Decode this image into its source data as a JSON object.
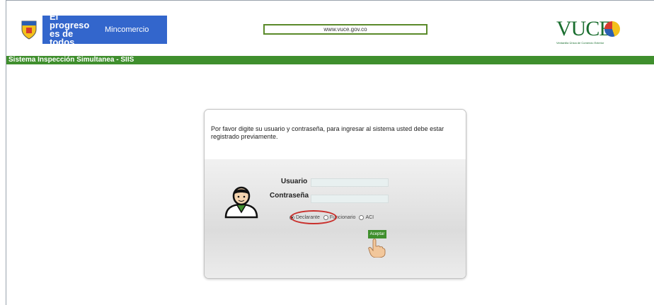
{
  "header": {
    "gov_logo_text": "El progreso es de todos",
    "ministry": "Mincomercio",
    "url": "www.vuce.gov.co",
    "vuce_logo": "VUCE",
    "vuce_subtitle": "Ventanilla Única de Comercio Exterior"
  },
  "bar": {
    "title": "Sistema Inspección Simultanea - SIIS"
  },
  "login": {
    "message": "Por favor digite su usuario y contraseña, para ingresar al sistema usted debe estar registrado previamente.",
    "user_label": "Usuario",
    "password_label": "Contraseña",
    "user_value": "",
    "password_value": "",
    "options": [
      "Declarante",
      "Funcionario",
      "ACI"
    ],
    "selected_option": "Declarante",
    "submit_label": "Aceptar"
  },
  "colors": {
    "brand_green": "#3f8f2d",
    "gov_blue": "#3366cc",
    "highlight_red": "#c9302c"
  }
}
